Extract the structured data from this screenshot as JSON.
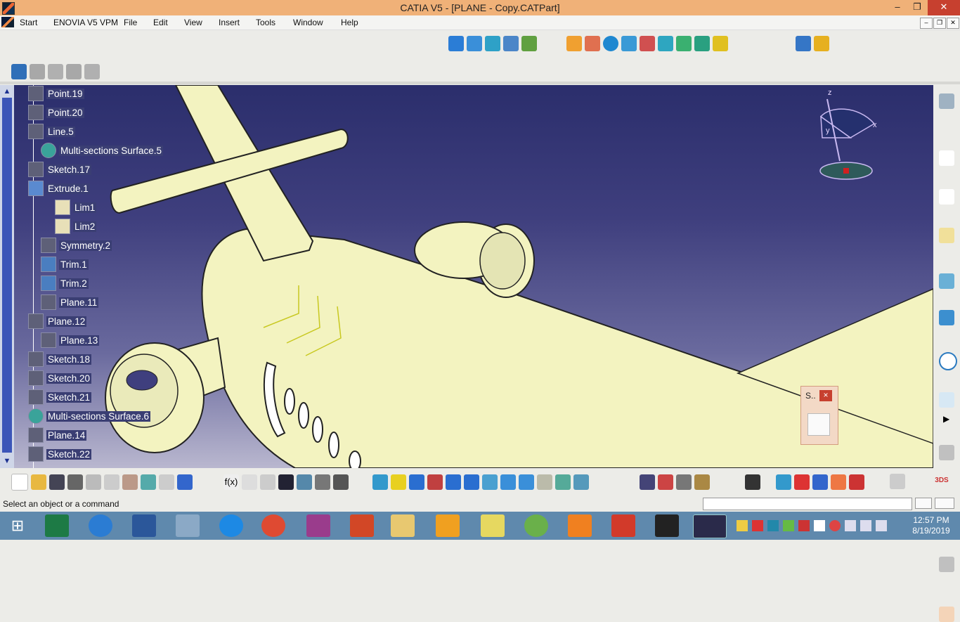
{
  "window": {
    "title": "CATIA V5 - [PLANE - Copy.CATPart]",
    "minimize_icon": "minimize-icon",
    "maximize_icon": "restore-icon",
    "close_icon": "close-icon"
  },
  "menu": {
    "items": [
      "Start",
      "ENOVIA V5 VPM",
      "File",
      "Edit",
      "View",
      "Insert",
      "Tools",
      "Window",
      "Help"
    ]
  },
  "tree": {
    "nodes": [
      {
        "label": "Point.19",
        "icon": "point-icon",
        "highlight": true
      },
      {
        "label": "Point.20",
        "icon": "point-icon",
        "highlight": true
      },
      {
        "label": "Line.5",
        "icon": "line-icon",
        "highlight": true
      },
      {
        "label": "Multi-sections Surface.5",
        "icon": "multi-sections-surface-icon",
        "highlight": true
      },
      {
        "label": "Sketch.17",
        "icon": "sketch-icon",
        "highlight": true
      },
      {
        "label": "Extrude.1",
        "icon": "extrude-icon",
        "highlight": true
      },
      {
        "label": "Lim1",
        "icon": "limit-icon",
        "highlight": true
      },
      {
        "label": "Lim2",
        "icon": "limit-icon",
        "highlight": true
      },
      {
        "label": "Symmetry.2",
        "icon": "symmetry-icon",
        "highlight": true
      },
      {
        "label": "Trim.1",
        "icon": "trim-icon",
        "highlight": true
      },
      {
        "label": "Trim.2",
        "icon": "trim-icon",
        "highlight": true
      },
      {
        "label": "Plane.11",
        "icon": "plane-icon",
        "highlight": true
      },
      {
        "label": "Plane.12",
        "icon": "plane-icon",
        "highlight": true
      },
      {
        "label": "Plane.13",
        "icon": "plane-icon",
        "highlight": true
      },
      {
        "label": "Sketch.18",
        "icon": "sketch-icon",
        "highlight": true
      },
      {
        "label": "Sketch.20",
        "icon": "sketch-icon",
        "highlight": true
      },
      {
        "label": "Sketch.21",
        "icon": "sketch-icon",
        "highlight": true
      },
      {
        "label": "Multi-sections Surface.6",
        "icon": "multi-sections-surface-icon",
        "highlight": true
      },
      {
        "label": "Plane.14",
        "icon": "plane-icon",
        "highlight": true
      },
      {
        "label": "Sketch.22",
        "icon": "sketch-icon",
        "highlight": true
      }
    ]
  },
  "compass": {
    "x": "x",
    "y": "y",
    "z": "z"
  },
  "sketch_toolbar": {
    "title": "S..",
    "close": "×"
  },
  "status": {
    "message": "Select an object or a command"
  },
  "taskbar": {
    "time": "12:57 PM",
    "date": "8/19/2019"
  },
  "colors": {
    "title_bar": "#f0b178",
    "viewport_top": "#2b2e6c",
    "model": "#f3f3c0",
    "taskbar": "#5f89ad",
    "close_button": "#c7402f"
  }
}
